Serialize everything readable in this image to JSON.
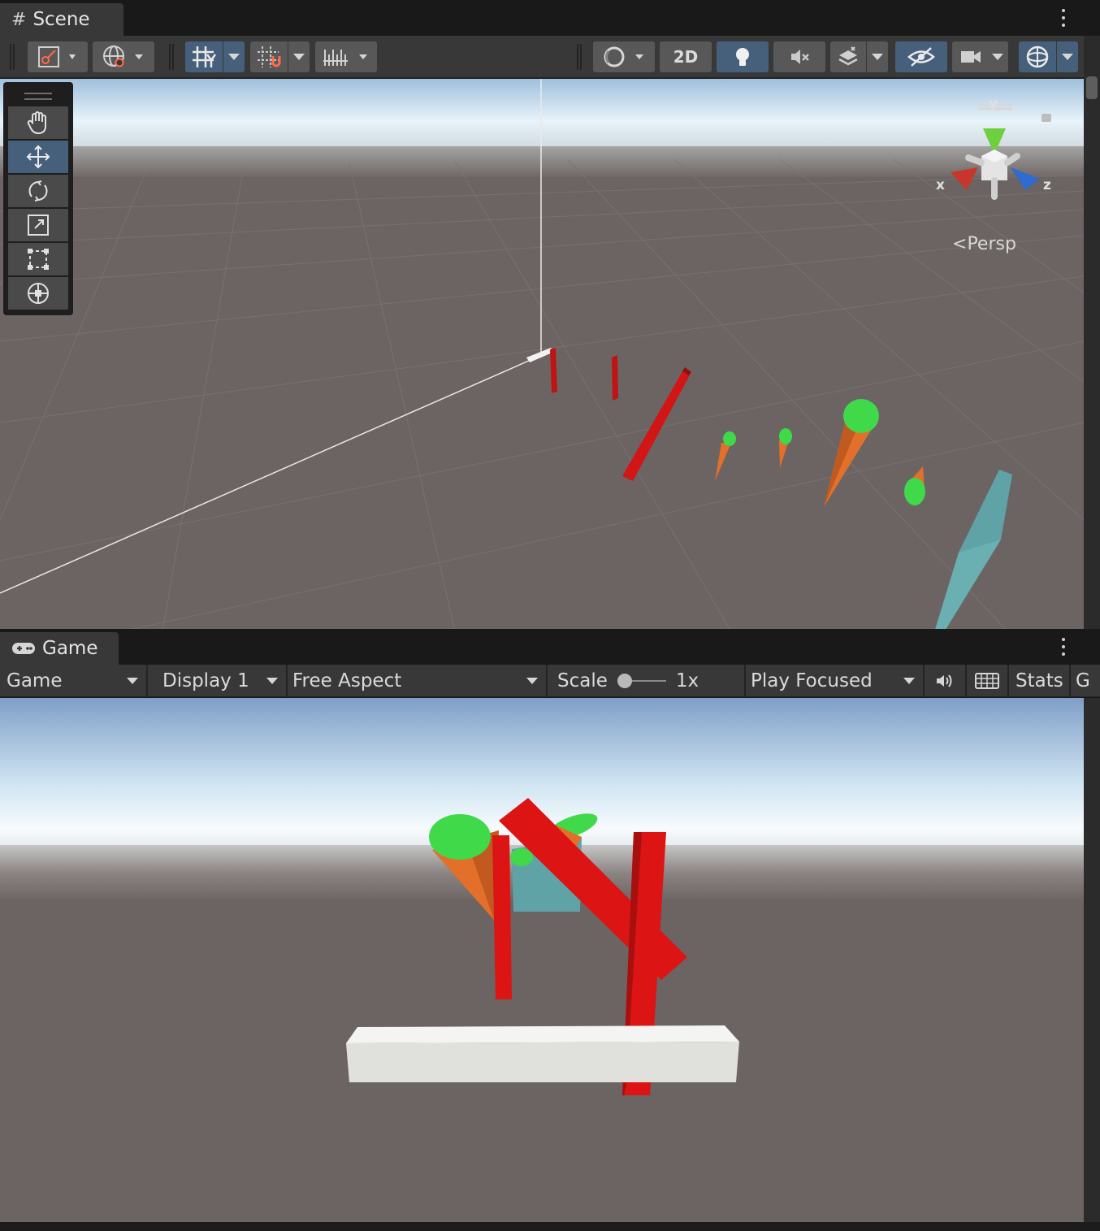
{
  "scene": {
    "tab_label": "Scene",
    "toolbar": {
      "btn_2d": "2D"
    },
    "tools": [
      "hand-tool",
      "move-tool",
      "rotate-tool",
      "scale-tool",
      "rect-tool",
      "transform-tool"
    ],
    "active_tool": "move-tool",
    "gizmo": {
      "x_label": "x",
      "y_label": "y",
      "z_label": "z",
      "projection_label": "Persp",
      "colors": {
        "x": "#c8362b",
        "y": "#6fcf3e",
        "z": "#2f6bd0"
      }
    }
  },
  "game": {
    "tab_label": "Game",
    "mode_dropdown": "Game",
    "display_dropdown": "Display 1",
    "aspect_dropdown": "Free Aspect",
    "scale_label": "Scale",
    "scale_value": "1x",
    "play_mode_dropdown": "Play Focused",
    "stats_label": "Stats",
    "overflow_label": "G"
  },
  "colors": {
    "red_object": "#dc1414",
    "carrot_orange": "#e2702a",
    "leaf_green": "#3fd94a",
    "teal_quad": "#5fa3a6",
    "active_button": "#46607c"
  }
}
